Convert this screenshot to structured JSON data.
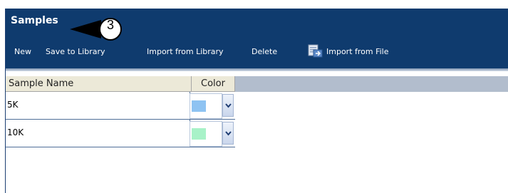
{
  "header": {
    "title": "Samples",
    "callout_number": "3"
  },
  "toolbar": {
    "new_label": "New",
    "save_to_library_label": "Save to Library",
    "import_from_library_label": "Import from Library",
    "delete_label": "Delete",
    "import_from_file_label": "Import from File",
    "import_from_file_icon": "file-import-icon"
  },
  "table": {
    "columns": [
      "Sample Name",
      "Color"
    ],
    "rows": [
      {
        "name": "5K",
        "color": "#8ec3f2"
      },
      {
        "name": "10K",
        "color": "#a8f2c8"
      }
    ]
  },
  "colors": {
    "header_bg": "#0f3b6e",
    "grid_header_bg": "#ece9d8",
    "grid_strip": "#b2bdcd"
  }
}
